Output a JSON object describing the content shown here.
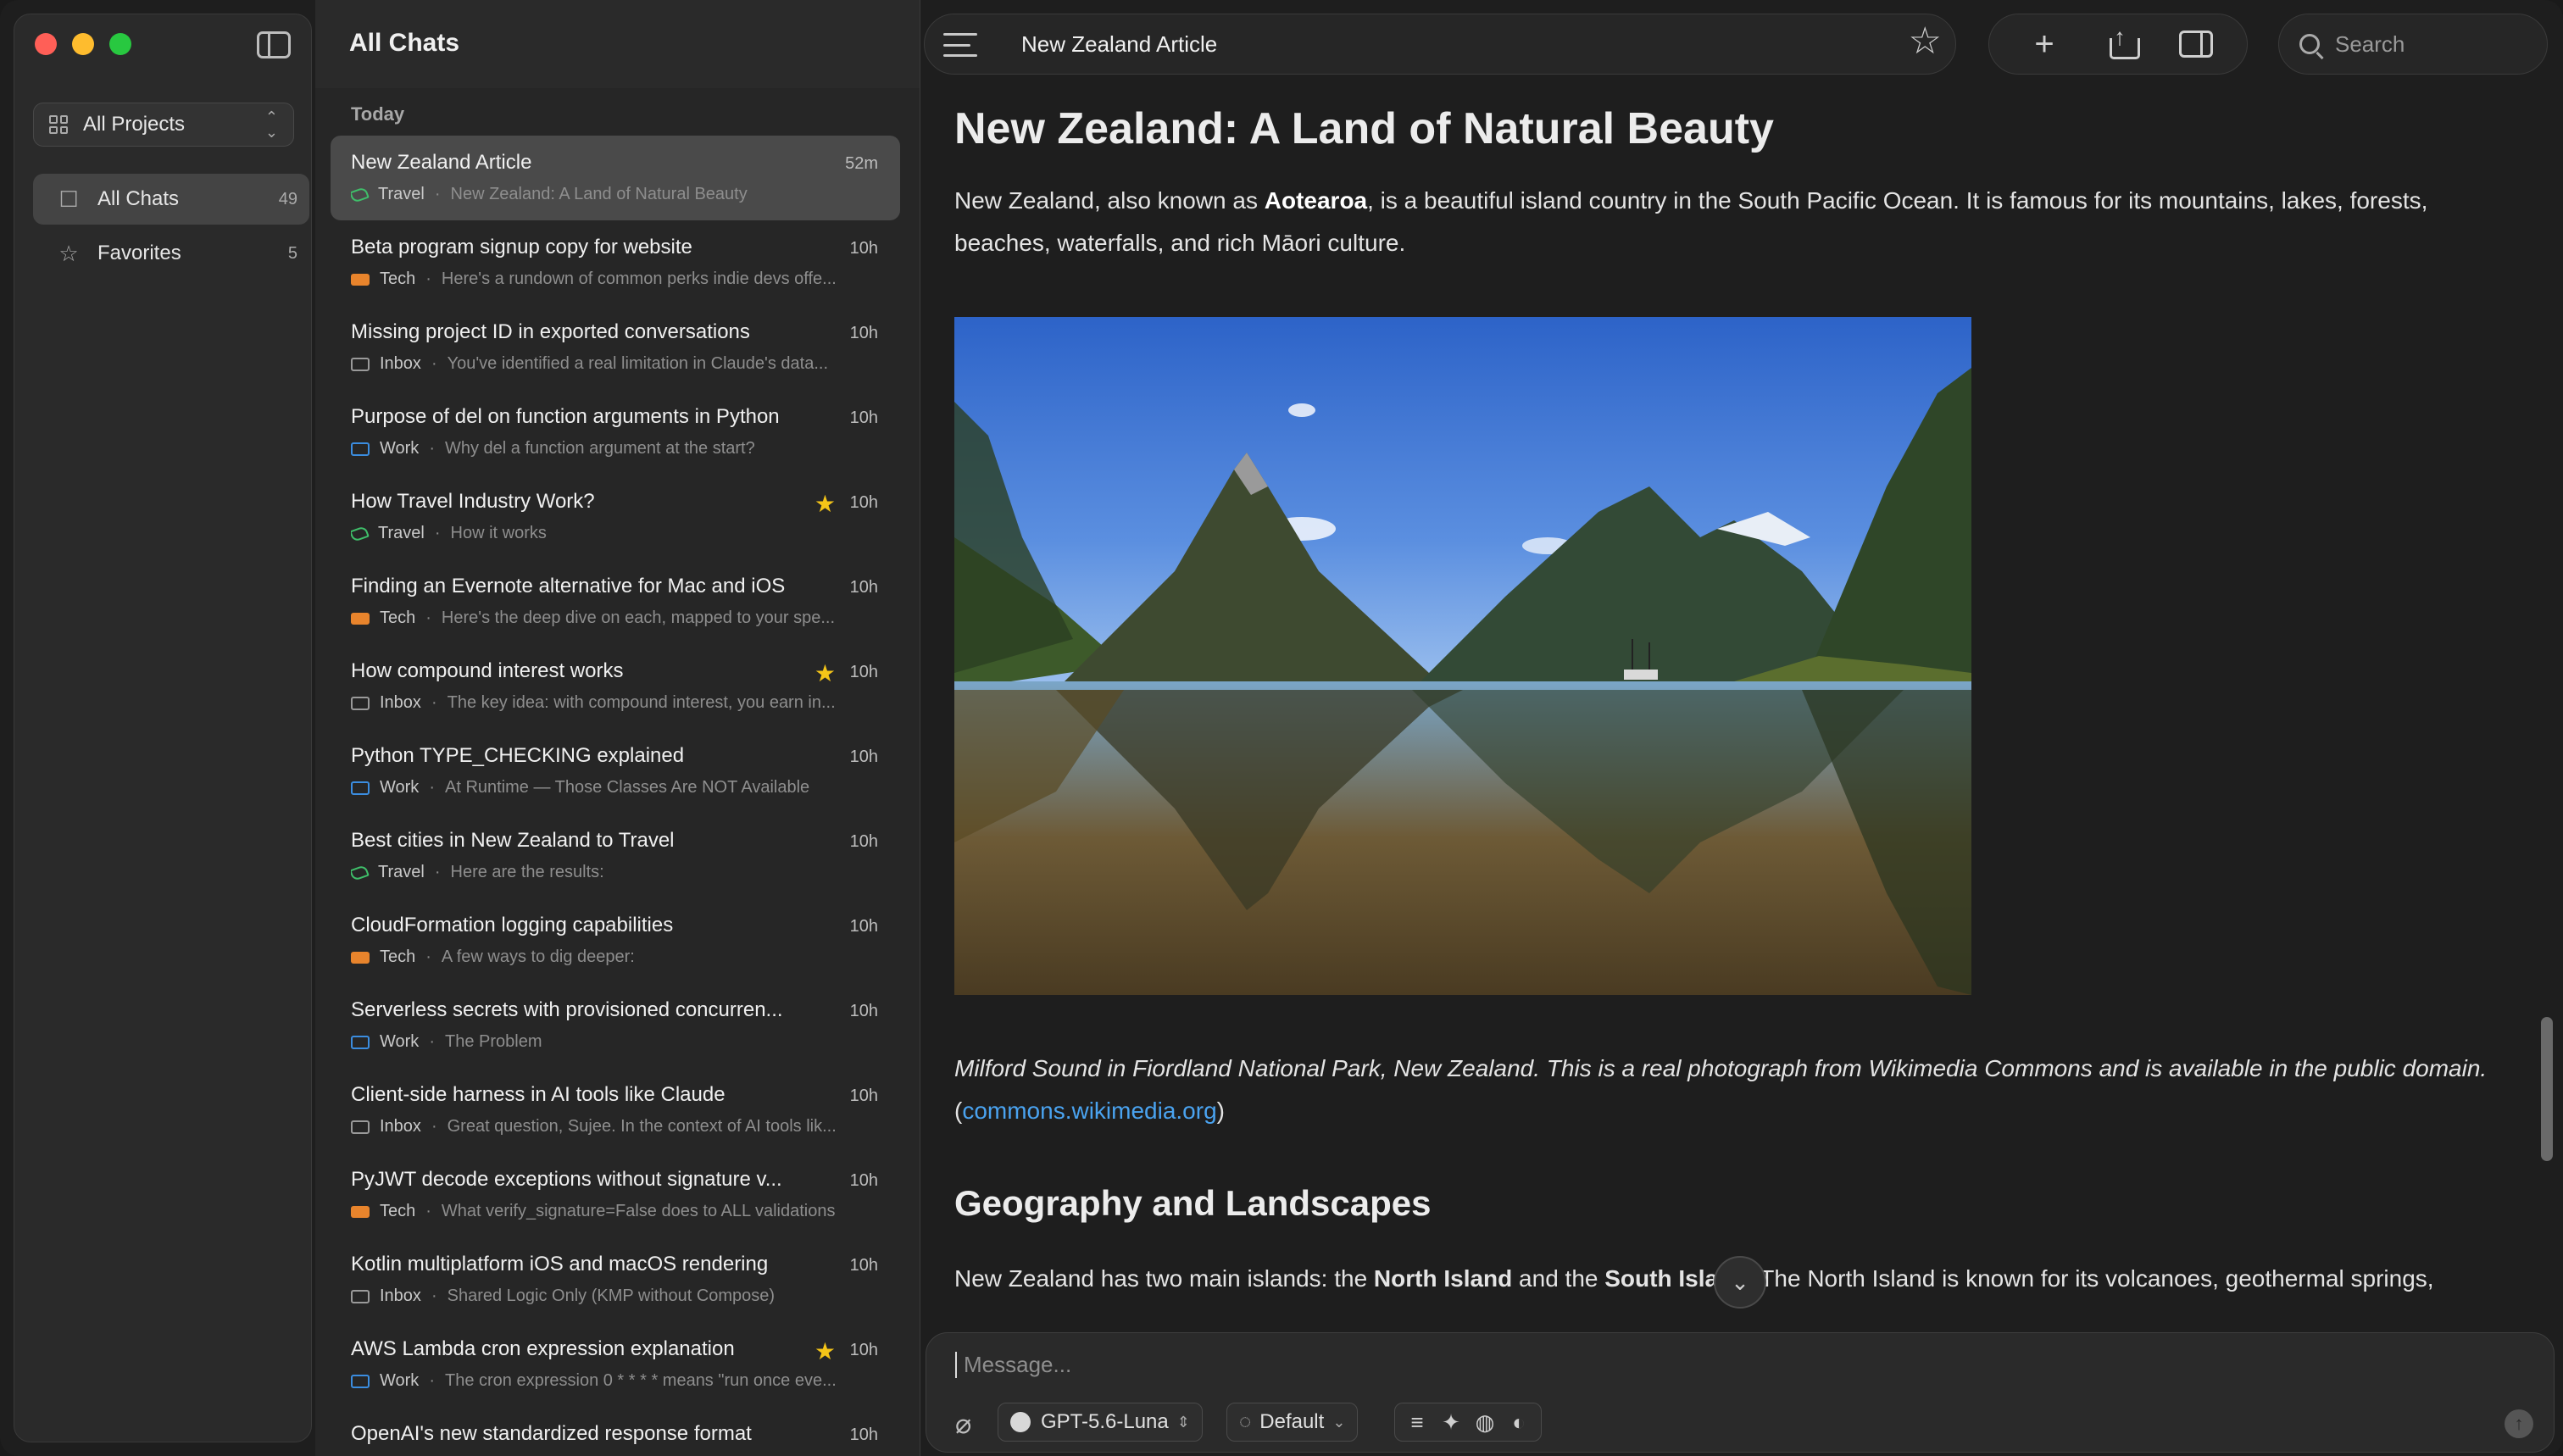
{
  "sidebar": {
    "project_select": "All Projects",
    "items": [
      {
        "label": "All Chats",
        "count": "49",
        "icon": "inbox-icon",
        "active": true
      },
      {
        "label": "Favorites",
        "count": "5",
        "icon": "star-icon",
        "active": false
      }
    ]
  },
  "chat_list": {
    "title": "All Chats",
    "section": "Today",
    "chats": [
      {
        "title": "New Zealand Article",
        "time": "52m",
        "category": "Travel",
        "preview": "New Zealand: A Land of Natural Beauty",
        "starred": false,
        "selected": true
      },
      {
        "title": "Beta program signup copy for website",
        "time": "10h",
        "category": "Tech",
        "preview": "Here's a rundown of common perks indie devs offe...",
        "starred": false
      },
      {
        "title": "Missing project ID in exported conversations",
        "time": "10h",
        "category": "Inbox",
        "preview": "You've identified a real limitation in Claude's data...",
        "starred": false
      },
      {
        "title": "Purpose of del on function arguments in Python",
        "time": "10h",
        "category": "Work",
        "preview": "Why del a function argument at the start?",
        "starred": false
      },
      {
        "title": "How Travel Industry Work?",
        "time": "10h",
        "category": "Travel",
        "preview": "How it works",
        "starred": true
      },
      {
        "title": "Finding an Evernote alternative for Mac and iOS",
        "time": "10h",
        "category": "Tech",
        "preview": "Here's the deep dive on each, mapped to your spe...",
        "starred": false
      },
      {
        "title": "How compound interest works",
        "time": "10h",
        "category": "Inbox",
        "preview": "The key idea: with compound interest, you earn in...",
        "starred": true
      },
      {
        "title": "Python TYPE_CHECKING explained",
        "time": "10h",
        "category": "Work",
        "preview": "At Runtime — Those Classes Are NOT Available",
        "starred": false
      },
      {
        "title": "Best cities in New Zealand to Travel",
        "time": "10h",
        "category": "Travel",
        "preview": "Here are the results:",
        "starred": false
      },
      {
        "title": "CloudFormation logging capabilities",
        "time": "10h",
        "category": "Tech",
        "preview": "A few ways to dig deeper:",
        "starred": false
      },
      {
        "title": "Serverless secrets with provisioned concurren...",
        "time": "10h",
        "category": "Work",
        "preview": "The Problem",
        "starred": false
      },
      {
        "title": "Client-side harness in AI tools like Claude",
        "time": "10h",
        "category": "Inbox",
        "preview": "Great question, Sujee. In the context of AI tools lik...",
        "starred": false
      },
      {
        "title": "PyJWT decode exceptions without signature v...",
        "time": "10h",
        "category": "Tech",
        "preview": "What verify_signature=False does to ALL validations",
        "starred": false
      },
      {
        "title": "Kotlin multiplatform iOS and macOS rendering",
        "time": "10h",
        "category": "Inbox",
        "preview": "Shared Logic Only (KMP without Compose)",
        "starred": false
      },
      {
        "title": "AWS Lambda cron expression explanation",
        "time": "10h",
        "category": "Work",
        "preview": "The cron expression 0 * * * * means \"run once eve...",
        "starred": true
      },
      {
        "title": "OpenAI's new standardized response format",
        "time": "10h",
        "category": "",
        "preview": "",
        "starred": false
      }
    ]
  },
  "topbar": {
    "title": "New Zealand Article",
    "search_placeholder": "Search"
  },
  "article": {
    "heading": "New Zealand: A Land of Natural Beauty",
    "intro_before": "New Zealand, also known as ",
    "intro_bold": "Aotearoa",
    "intro_after": ", is a beautiful island country in the South Pacific Ocean. It is famous for its mountains, lakes, forests, beaches, waterfalls, and rich Māori culture.",
    "caption_text": "Milford Sound in Fiordland National Park, New Zealand. This is a real photograph from Wikimedia Commons and is available in the public domain.",
    "caption_link": "commons.wikimedia.org",
    "section2_heading": "Geography and Landscapes",
    "p2_a": "New Zealand has two main islands: the ",
    "p2_b1": "North Island",
    "p2_c": " and the ",
    "p2_b2": "South Island",
    "p2_d": ". The North Island is known for its volcanoes, geothermal springs,"
  },
  "composer": {
    "placeholder": "Message...",
    "model": "GPT-5.6-Luna",
    "preset": "Default"
  },
  "colors": {
    "travel": "#3fbf6a",
    "tech": "#e8842c",
    "work": "#3b8de0",
    "inbox": "#9a9a9a",
    "star": "#f5c518",
    "link": "#4aa3f0"
  }
}
